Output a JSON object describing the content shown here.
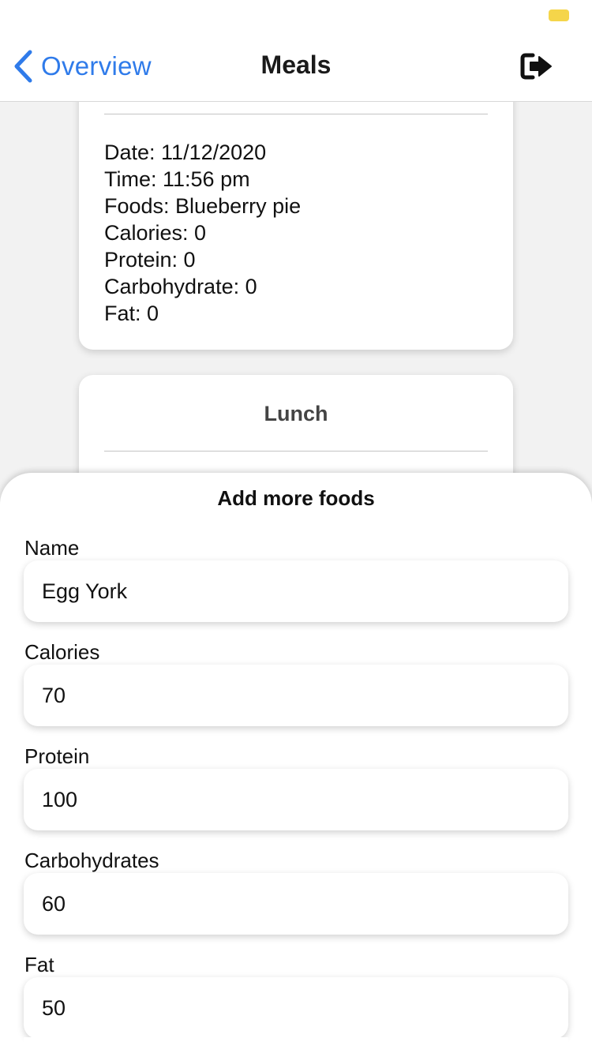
{
  "nav": {
    "back_label": "Overview",
    "title": "Meals",
    "logout_icon": "sign-out-icon"
  },
  "cards": {
    "breakfast": {
      "lines": [
        "Date: 11/12/2020",
        "Time: 11:56 pm",
        "Foods: Blueberry pie",
        "Calories: 0",
        "Protein: 0",
        "Carbohydrate: 0",
        "Fat: 0"
      ]
    },
    "lunch": {
      "title": "Lunch"
    }
  },
  "sheet": {
    "title": "Add more foods",
    "fields": [
      {
        "label": "Name",
        "value": "Egg York"
      },
      {
        "label": "Calories",
        "value": "70"
      },
      {
        "label": "Protein",
        "value": "100"
      },
      {
        "label": "Carbohydrates",
        "value": "60"
      },
      {
        "label": "Fat",
        "value": "50"
      }
    ]
  },
  "colors": {
    "accent": "#2f7bea",
    "battery": "#f5d54a"
  }
}
